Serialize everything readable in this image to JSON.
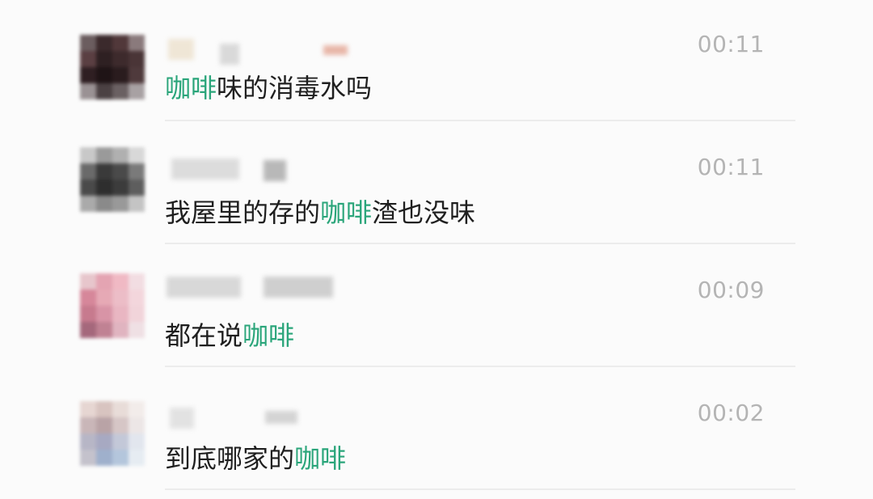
{
  "keyword_color": "#2aa57a",
  "results": [
    {
      "time": "00:11",
      "msg_pre": "",
      "msg_kw": "咖啡",
      "msg_post": "味的消毒水吗"
    },
    {
      "time": "00:11",
      "msg_pre": "我屋里的存的",
      "msg_kw": "咖啡",
      "msg_post": "渣也没味"
    },
    {
      "time": "00:09",
      "msg_pre": "都在说",
      "msg_kw": "咖啡",
      "msg_post": ""
    },
    {
      "time": "00:02",
      "msg_pre": "到底哪家的",
      "msg_kw": "咖啡",
      "msg_post": ""
    }
  ]
}
